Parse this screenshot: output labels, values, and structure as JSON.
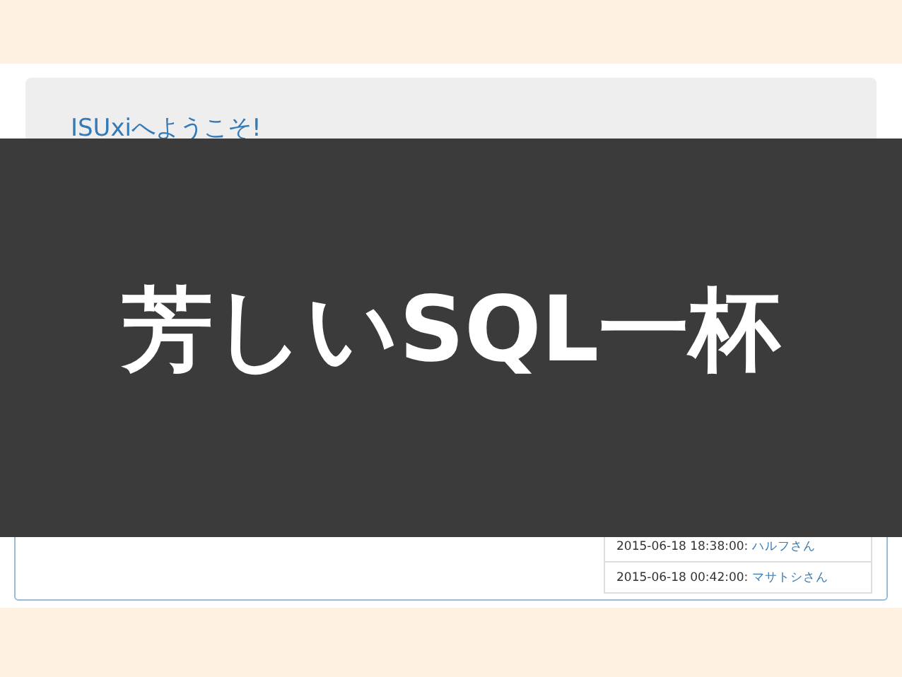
{
  "jumbotron": {
    "title": "ISUxiへようこそ!"
  },
  "footprints": {
    "items": [
      {
        "time": "2015-06-18 18:38:00:",
        "name": "ハルフさん"
      },
      {
        "time": "2015-06-18 00:42:00:",
        "name": "マサトシさん"
      }
    ]
  },
  "overlay": {
    "caption": "芳しいSQL一杯"
  }
}
